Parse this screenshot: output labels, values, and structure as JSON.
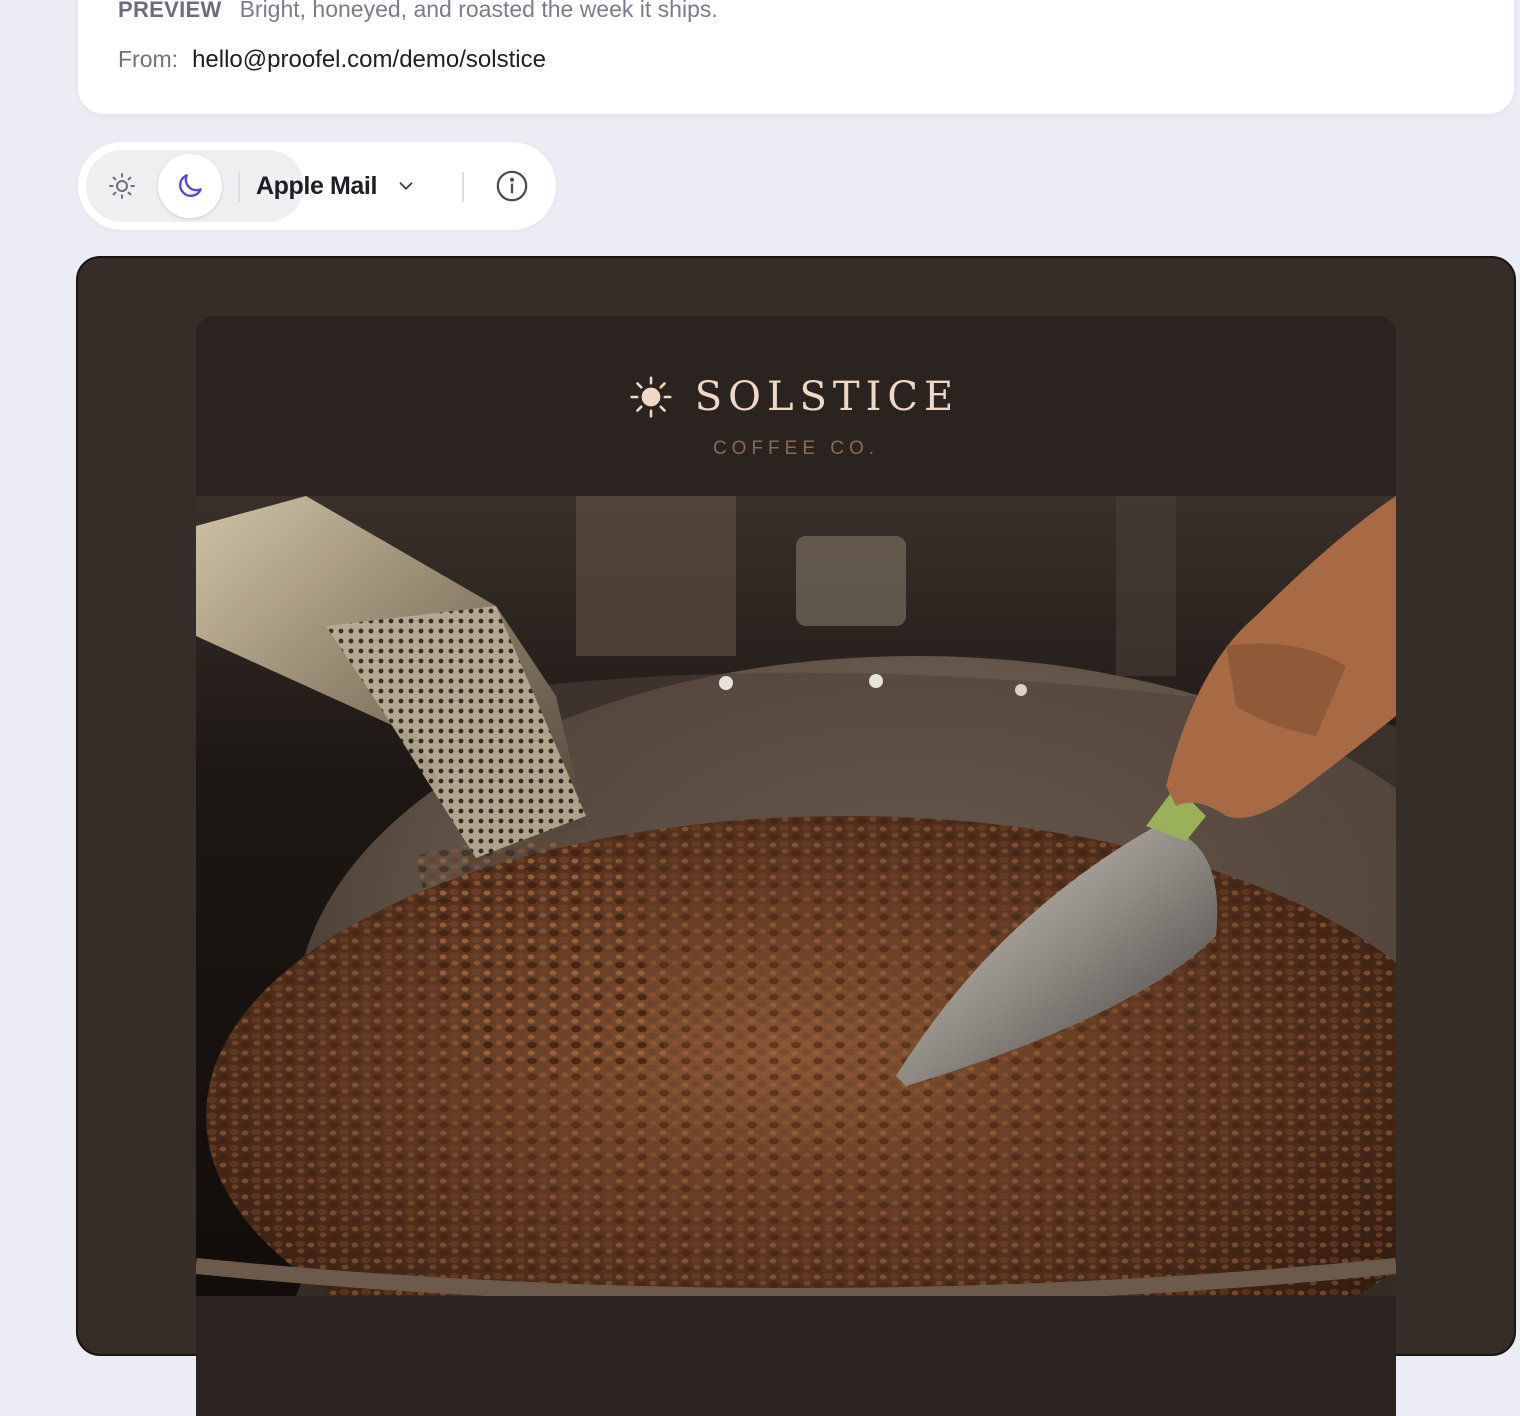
{
  "header": {
    "preview_label": "PREVIEW",
    "preview_text": "Bright, honeyed, and roasted the week it ships.",
    "from_label": "From:",
    "from_value": "hello@proofel.com/demo/solstice"
  },
  "toolbar": {
    "light_mode_icon": "sun-icon",
    "dark_mode_icon": "moon-icon",
    "active_mode": "dark",
    "client_label": "Apple Mail",
    "client_dropdown_icon": "chevron-down-icon",
    "info_icon": "info-icon",
    "accent_color": "#5b47d6"
  },
  "email": {
    "brand_icon": "sun-icon",
    "brand_name": "SOLSTICE",
    "brand_tagline": "COFFEE CO.",
    "hero_image": "coffee-roaster-beans-photo",
    "background_color": "#2b2320",
    "frame_color": "#362d28"
  }
}
